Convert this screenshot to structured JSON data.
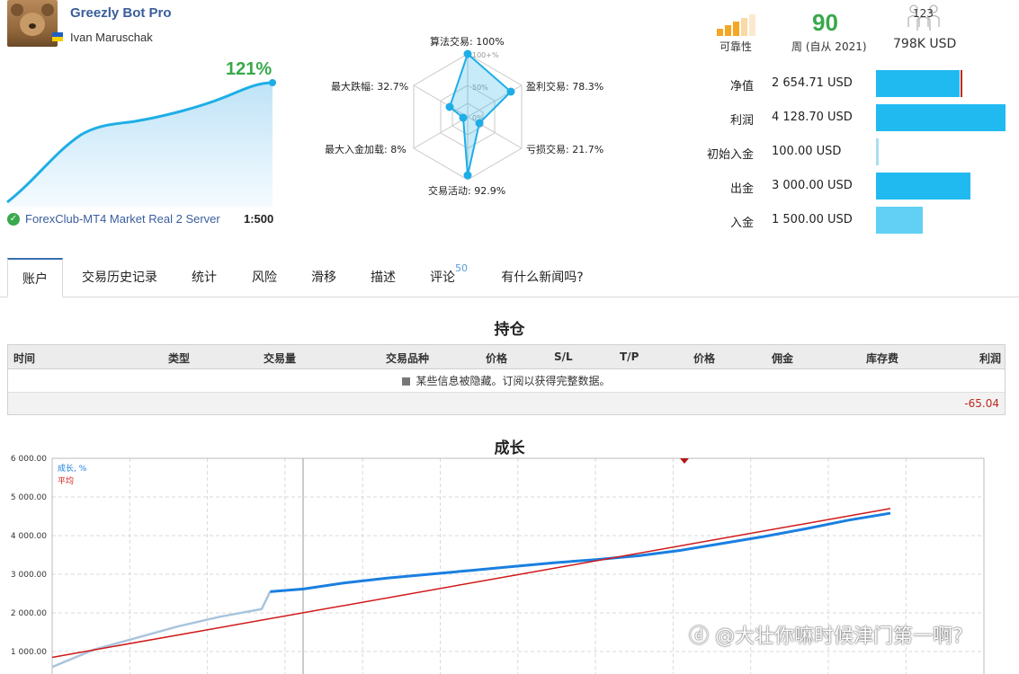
{
  "header": {
    "bot_name": "Greezly Bot Pro",
    "author": "Ivan Maruschak",
    "gain": "121%",
    "server": "ForexClub-MT4 Market Real 2 Server",
    "leverage": "1:500"
  },
  "radar": {
    "labels": [
      {
        "text": "算法交易: 100%",
        "value": 100
      },
      {
        "text": "盈利交易: 78.3%",
        "value": 78.3
      },
      {
        "text": "亏损交易: 21.7%",
        "value": 21.7
      },
      {
        "text": "交易活动: 92.9%",
        "value": 92.9
      },
      {
        "text": "最大入金加载: 8%",
        "value": 8
      },
      {
        "text": "最大跌幅: 32.7%",
        "value": 32.7
      }
    ],
    "rings": [
      "100+%",
      "50%",
      "0%"
    ]
  },
  "stats": {
    "reliability_label": "可靠性",
    "weeks_value": "90",
    "weeks_label": "周 (自从 2021)",
    "subscribers": "123",
    "subscribers_funds": "798K USD"
  },
  "finance": [
    {
      "key": "净值",
      "value": "2 654.71 USD",
      "amount": 2654.71,
      "color": "#20baf0"
    },
    {
      "key": "利润",
      "value": "4 128.70 USD",
      "amount": 4128.7,
      "color": "#20baf0"
    },
    {
      "key": "初始入金",
      "value": "100.00 USD",
      "amount": 100.0,
      "color": "#a9dff3"
    },
    {
      "key": "出金",
      "value": "3 000.00 USD",
      "amount": 3000.0,
      "color": "#20baf0"
    },
    {
      "key": "入金",
      "value": "1 500.00 USD",
      "amount": 1500.0,
      "color": "#62d0f5"
    }
  ],
  "tabs": [
    "账户",
    "交易历史记录",
    "统计",
    "风险",
    "滑移",
    "描述",
    "评论",
    "有什么新闻吗?"
  ],
  "tab_badge": "50",
  "positions": {
    "title": "持仓",
    "columns": [
      "时间",
      "类型",
      "交易量",
      "交易品种",
      "价格",
      "S/L",
      "T/P",
      "价格",
      "佣金",
      "库存费",
      "利润"
    ],
    "note": "某些信息被隐藏。订阅以获得完整数据。",
    "total": "-65.04"
  },
  "growth": {
    "title": "成长",
    "legend_growth": "成长, %",
    "legend_avg": "平均"
  },
  "chart_data": {
    "type": "line",
    "title": "成长",
    "y_ticks": [
      "6 000.00",
      "5 000.00",
      "4 000.00",
      "3 000.00",
      "2 000.00",
      "1 000.00"
    ],
    "ylim": [
      700,
      6000
    ],
    "series": [
      {
        "name": "成长, %",
        "color": "#1a7fe0",
        "x": [
          0,
          0.05,
          0.1,
          0.15,
          0.2,
          0.25,
          0.26,
          0.3,
          0.35,
          0.4,
          0.45,
          0.5,
          0.55,
          0.6,
          0.65,
          0.7,
          0.75,
          0.8,
          0.85,
          0.9,
          0.95,
          1
        ],
        "values": [
          600,
          1050,
          1350,
          1650,
          1900,
          2100,
          2550,
          2620,
          2780,
          2900,
          3000,
          3100,
          3200,
          3300,
          3380,
          3480,
          3620,
          3800,
          3980,
          4180,
          4400,
          4580
        ]
      },
      {
        "name": "平均",
        "color": "#d01818",
        "x": [
          0,
          1
        ],
        "values": [
          850,
          4700
        ]
      }
    ]
  }
}
